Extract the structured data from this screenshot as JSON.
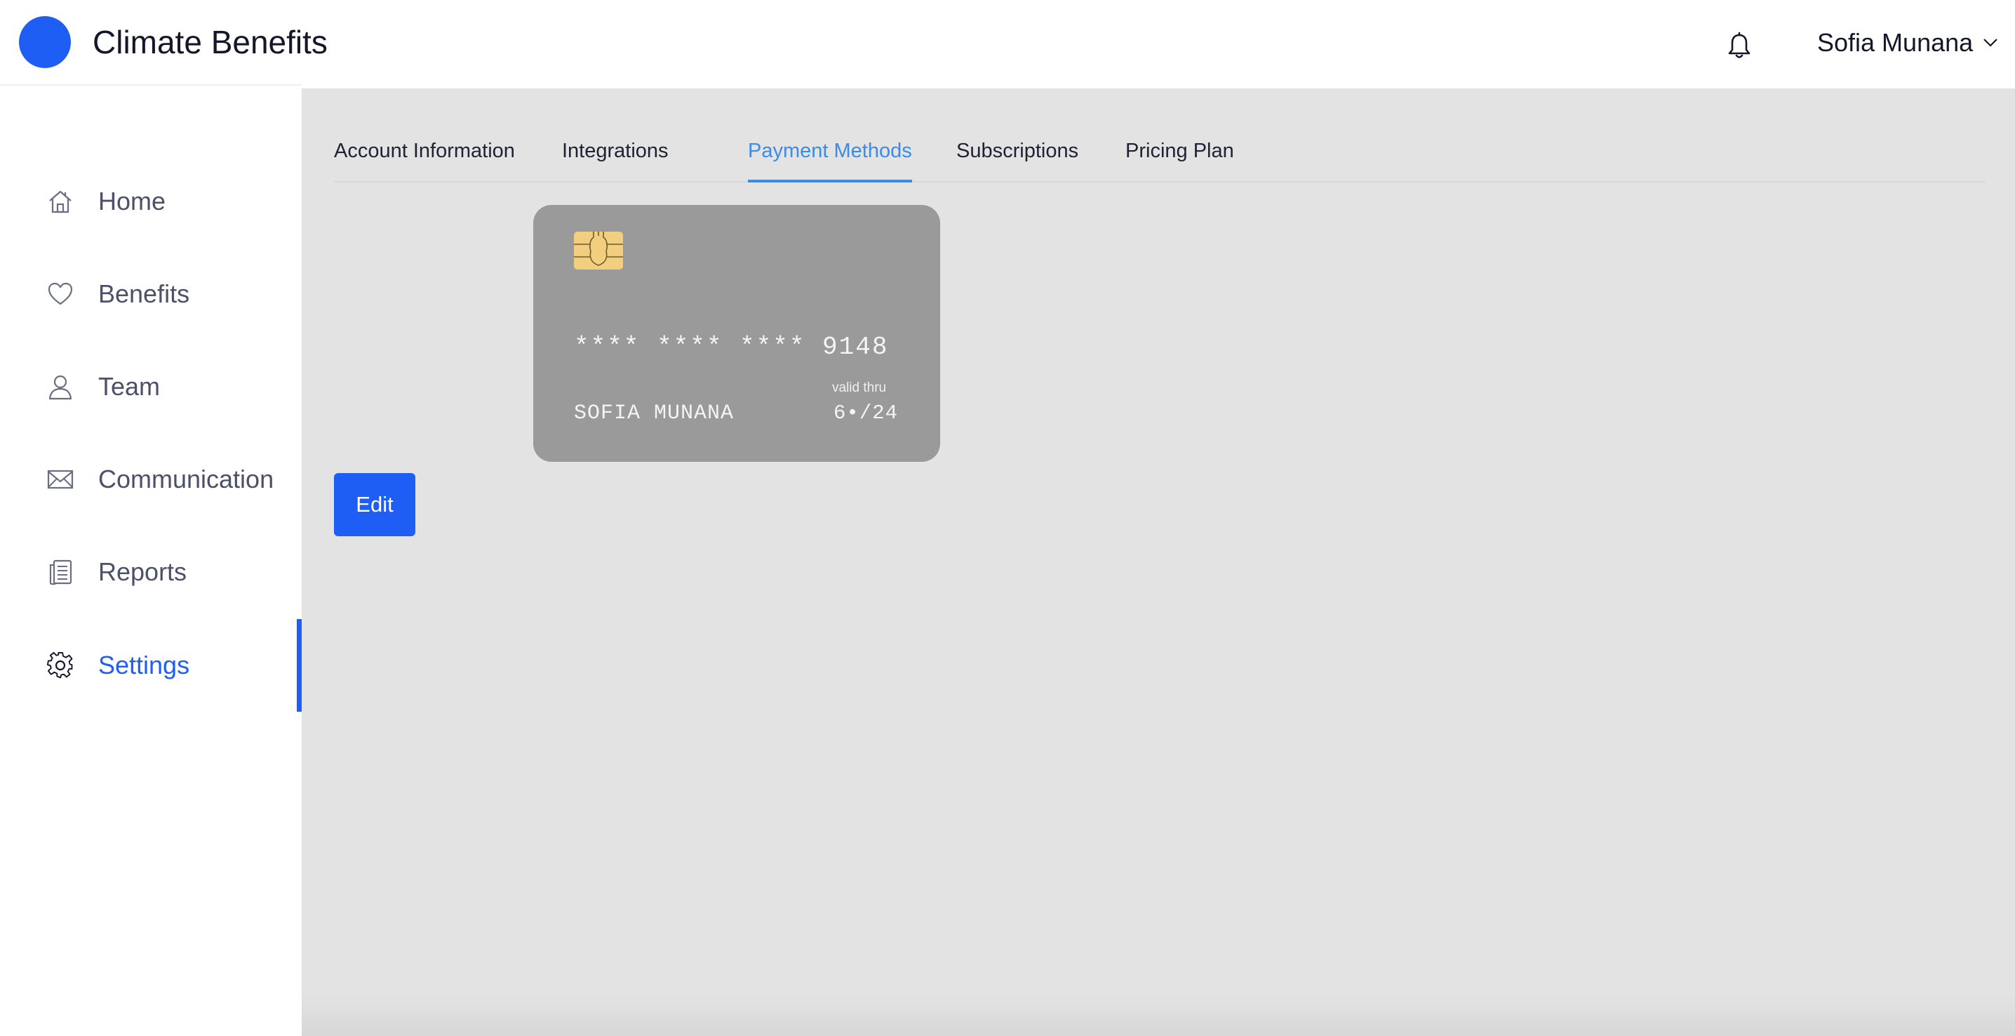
{
  "app": {
    "title": "Climate Benefits",
    "brand_color": "#1f5ef5"
  },
  "header": {
    "notification_icon": "bell-icon",
    "user_name": "Sofia Munana",
    "user_menu_icon": "chevron-down-icon"
  },
  "sidebar": {
    "items": [
      {
        "label": "Home",
        "icon": "home-icon",
        "active": false
      },
      {
        "label": "Benefits",
        "icon": "heart-icon",
        "active": false
      },
      {
        "label": "Team",
        "icon": "user-icon",
        "active": false
      },
      {
        "label": "Communication",
        "icon": "mail-icon",
        "active": false
      },
      {
        "label": "Reports",
        "icon": "document-icon",
        "active": false
      },
      {
        "label": "Settings",
        "icon": "gear-icon",
        "active": true
      }
    ]
  },
  "settings": {
    "tabs": [
      {
        "label": "Account Information",
        "active": false
      },
      {
        "label": "Integrations",
        "active": false
      },
      {
        "label": "Payment Methods",
        "active": true
      },
      {
        "label": "Subscriptions",
        "active": false
      },
      {
        "label": "Pricing Plan",
        "active": false
      }
    ],
    "active_tab_color": "#3b8be7"
  },
  "payment_card": {
    "number": "**** **** **** 9148",
    "valid_thru_label": "valid thru",
    "holder_name": "SOFIA MUNANA",
    "expiry": "6•/24",
    "chip_icon": "card-chip-icon",
    "card_color": "#9a9a9a"
  },
  "actions": {
    "edit_label": "Edit"
  }
}
